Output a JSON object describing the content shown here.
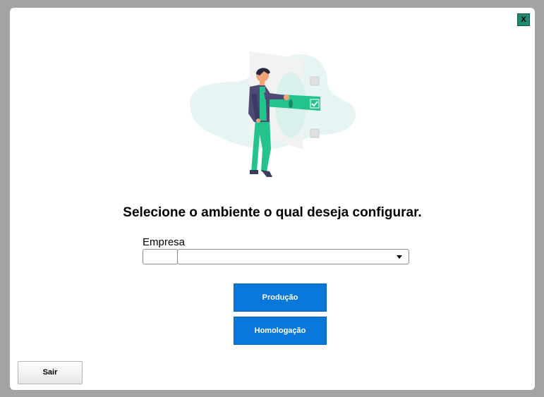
{
  "dialog": {
    "close_label": "X",
    "title": "Selecione o ambiente o qual deseja configurar.",
    "illustration_icon": "person-selecting-checklist-illustration"
  },
  "form": {
    "company_label": "Empresa",
    "company_code_value": "",
    "company_select_value": ""
  },
  "buttons": {
    "production_label": "Produção",
    "staging_label": "Homologação",
    "exit_label": "Sair"
  },
  "colors": {
    "primary_button": "#0a78da",
    "close_button": "#1f8a72",
    "backdrop": "#a3a3a3",
    "illustration_accent": "#24c38e",
    "illustration_blob": "#e6f4f3"
  }
}
